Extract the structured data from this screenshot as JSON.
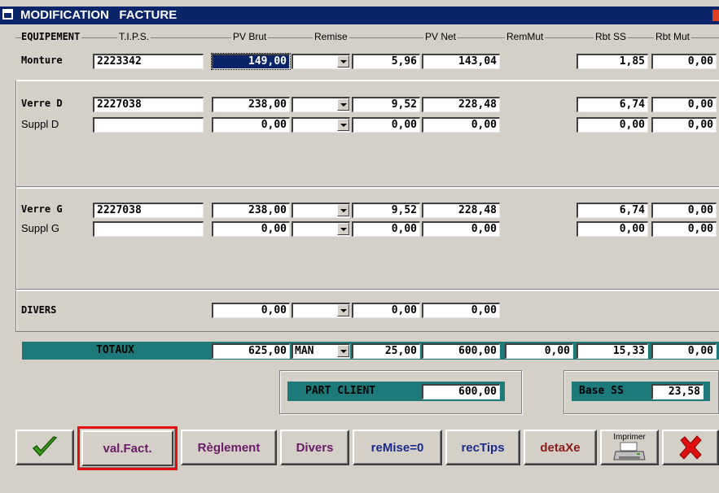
{
  "window": {
    "title": "MODIFICATION   FACTURE"
  },
  "headers": {
    "equipement": "EQUIPEMENT",
    "tips": "T.I.P.S.",
    "pv_brut": "PV Brut",
    "remise": "Remise",
    "pv_net": "PV Net",
    "remmut": "RemMut",
    "rbt_ss": "Rbt SS",
    "rbt_mut": "Rbt Mut"
  },
  "rows": {
    "monture": {
      "label": "Monture",
      "tips": "2223342",
      "pv_brut": "149,00",
      "remise_code": "",
      "remise": "5,96",
      "pv_net": "143,04",
      "rbt_ss": "1,85",
      "rbt_mut": "0,00"
    },
    "verre_d": {
      "label": "Verre D",
      "tips": "2227038",
      "pv_brut": "238,00",
      "remise_code": "",
      "remise": "9,52",
      "pv_net": "228,48",
      "rbt_ss": "6,74",
      "rbt_mut": "0,00"
    },
    "suppl_d": {
      "label": "Suppl D",
      "tips": "",
      "pv_brut": "0,00",
      "remise_code": "",
      "remise": "0,00",
      "pv_net": "0,00",
      "rbt_ss": "0,00",
      "rbt_mut": "0,00"
    },
    "verre_g": {
      "label": "Verre G",
      "tips": "2227038",
      "pv_brut": "238,00",
      "remise_code": "",
      "remise": "9,52",
      "pv_net": "228,48",
      "rbt_ss": "6,74",
      "rbt_mut": "0,00"
    },
    "suppl_g": {
      "label": "Suppl G",
      "tips": "",
      "pv_brut": "0,00",
      "remise_code": "",
      "remise": "0,00",
      "pv_net": "0,00",
      "rbt_ss": "0,00",
      "rbt_mut": "0,00"
    },
    "divers": {
      "label": "DIVERS",
      "pv_brut": "0,00",
      "remise_code": "",
      "remise": "0,00",
      "pv_net": "0,00"
    }
  },
  "totaux": {
    "label": "TOTAUX",
    "pv_brut": "625,00",
    "remise_code": "MAN",
    "remise": "25,00",
    "pv_net": "600,00",
    "remmut": "0,00",
    "rbt_ss": "15,33",
    "rbt_mut": "0,00"
  },
  "part_client": {
    "label": "PART CLIENT",
    "value": "600,00"
  },
  "base_ss": {
    "label": "Base SS",
    "value": "23,58"
  },
  "buttons": {
    "valfact": "val.Fact.",
    "reglement": "Règlement",
    "divers": "Divers",
    "remise0": "reMise=0",
    "rectips": "recTips",
    "detaxe": "detaXe",
    "imprimer": "Imprimer"
  },
  "colors": {
    "title_bg": "#0a246a",
    "teal": "#1e7a7a",
    "highlight": "#e01010",
    "check": "#3aa01a",
    "cancel": "#e01010"
  }
}
